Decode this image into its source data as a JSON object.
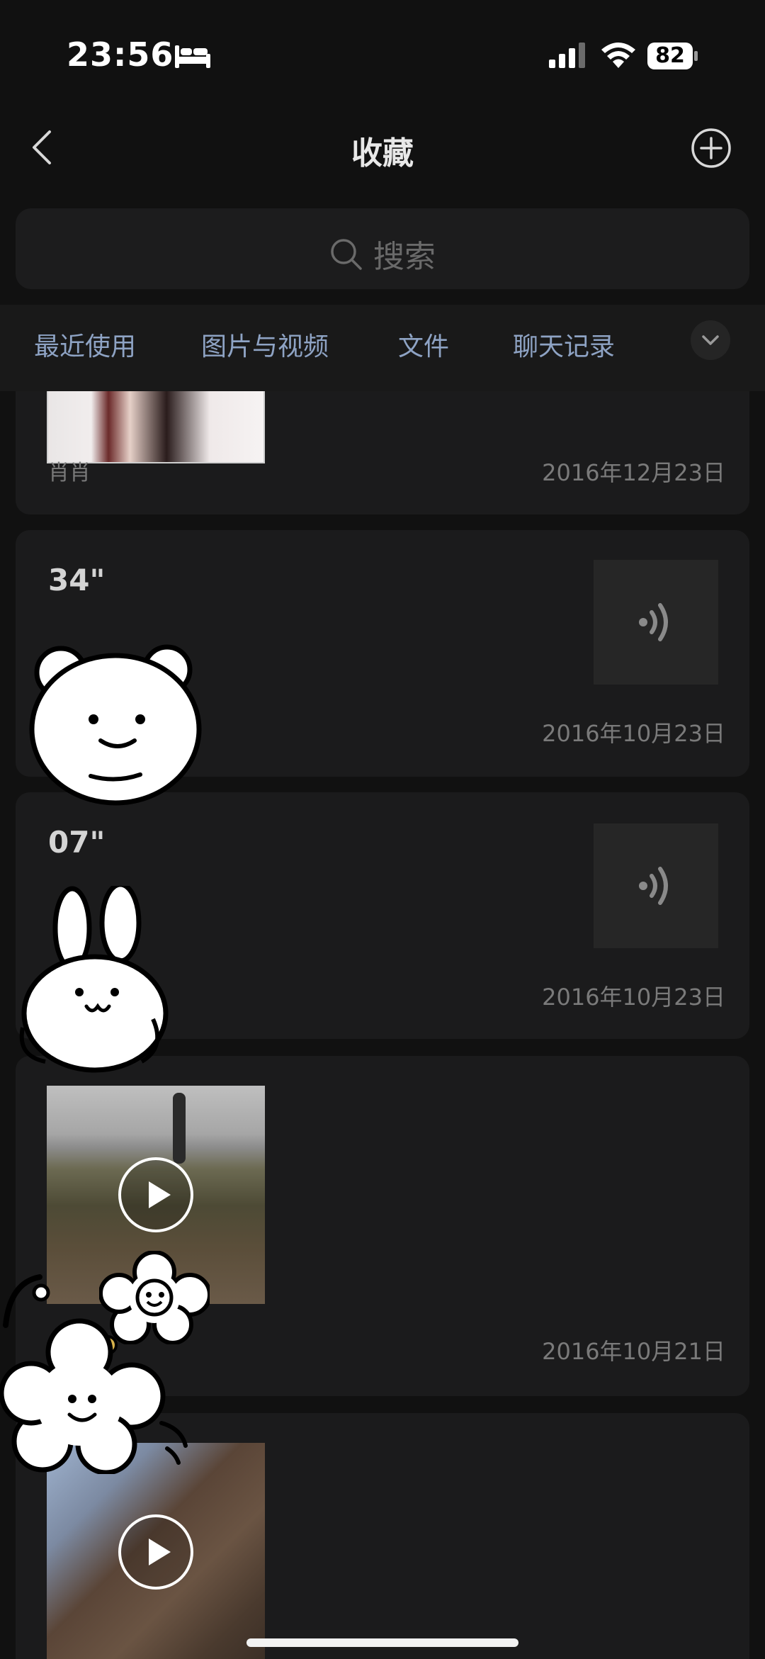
{
  "status_bar": {
    "time": "23:56",
    "battery": "82"
  },
  "header": {
    "title": "收藏"
  },
  "search": {
    "placeholder": "搜索"
  },
  "tabs": [
    {
      "label": "最近使用"
    },
    {
      "label": "图片与视频"
    },
    {
      "label": "文件"
    },
    {
      "label": "聊天记录"
    }
  ],
  "items": [
    {
      "type": "image",
      "source": "肖肖",
      "date": "2016年12月23日"
    },
    {
      "type": "voice",
      "duration": "34\"",
      "date": "2016年10月23日"
    },
    {
      "type": "voice",
      "duration": "07\"",
      "date": "2016年10月23日"
    },
    {
      "type": "video",
      "date": "2016年10月21日"
    },
    {
      "type": "video",
      "date": ""
    }
  ],
  "icons": {
    "back": "chevron-left-icon",
    "add": "plus-circle-icon",
    "search": "search-icon",
    "more": "chevron-down-icon",
    "voice": "voice-wave-icon",
    "play": "play-icon"
  },
  "colors": {
    "background": "#111111",
    "card": "#1b1b1c",
    "tab_text": "#8ea3c4"
  }
}
